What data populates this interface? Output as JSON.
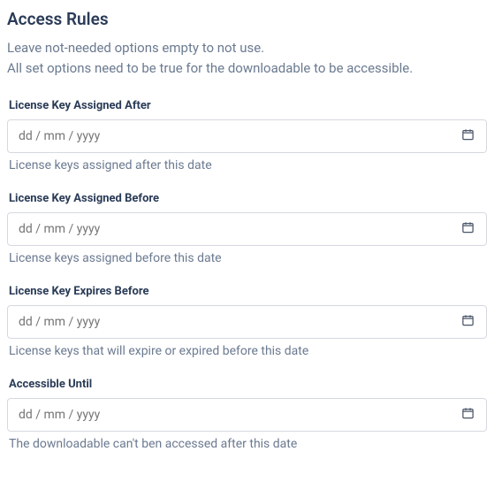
{
  "section": {
    "title": "Access Rules",
    "description_line1": "Leave not-needed options empty to not use.",
    "description_line2": "All set options need to be true for the downloadable to be accessible."
  },
  "fields": {
    "assigned_after": {
      "label": "License Key Assigned After",
      "placeholder": "dd / mm / yyyy",
      "help": "License keys assigned after this date"
    },
    "assigned_before": {
      "label": "License Key Assigned Before",
      "placeholder": "dd / mm / yyyy",
      "help": "License keys assigned before this date"
    },
    "expires_before": {
      "label": "License Key Expires Before",
      "placeholder": "dd / mm / yyyy",
      "help": "License keys that will expire or expired before this date"
    },
    "accessible_until": {
      "label": "Accessible Until",
      "placeholder": "dd / mm / yyyy",
      "help": "The downloadable can't ben accessed after this date"
    }
  }
}
